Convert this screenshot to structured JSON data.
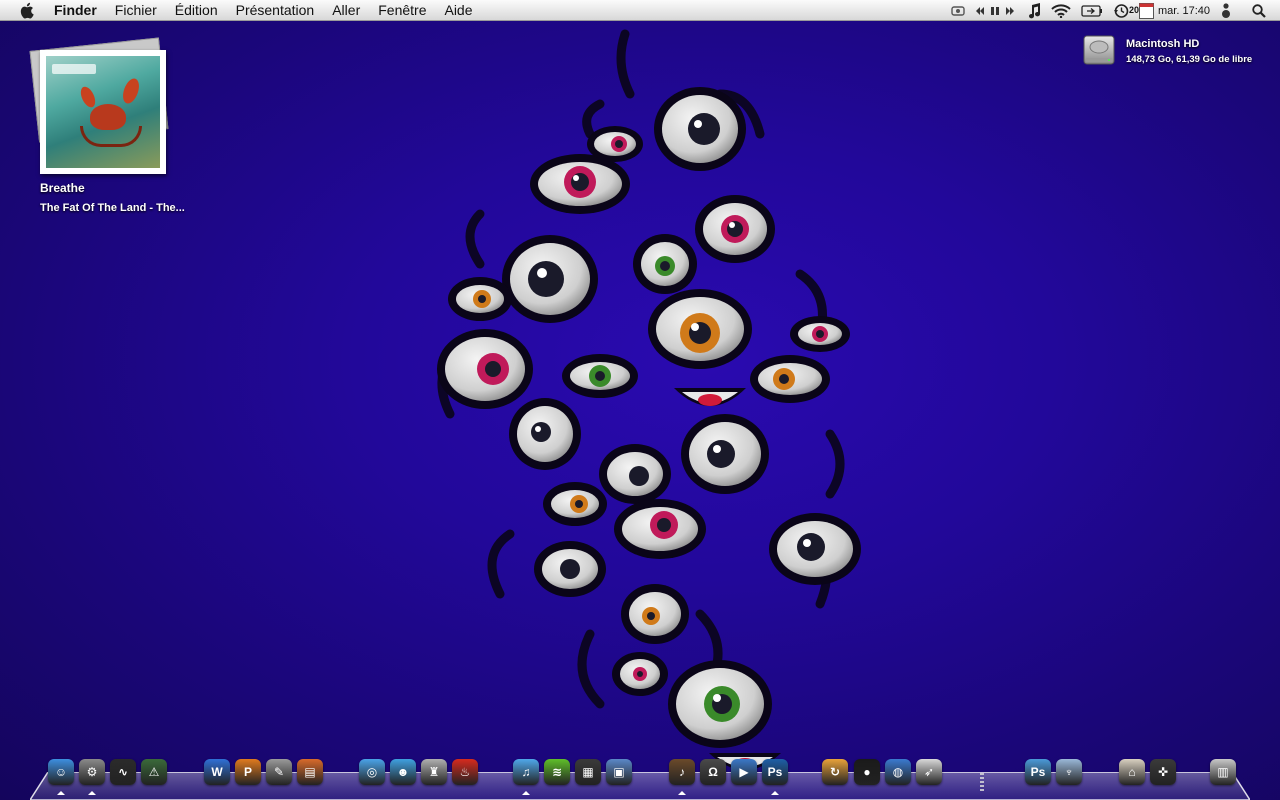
{
  "menubar": {
    "apple_icon": "apple-icon",
    "app_name": "Finder",
    "menus": [
      "Fichier",
      "Édition",
      "Présentation",
      "Aller",
      "Fenêtre",
      "Aide"
    ],
    "status": {
      "date_day": "20",
      "clock": "mar. 17:40"
    }
  },
  "album": {
    "title": "Breathe",
    "subtitle": "The Fat Of The Land - The..."
  },
  "disk": {
    "name": "Macintosh HD",
    "info": "148,73 Go, 61,39 Go de libre"
  },
  "dock": {
    "items": [
      {
        "name": "finder",
        "icon": "finder-icon",
        "color": "#3d8fe0",
        "running": true
      },
      {
        "name": "system-preferences",
        "icon": "gear-icon",
        "color": "#8a8a8a",
        "running": true
      },
      {
        "name": "activity-monitor",
        "icon": "activity-monitor-icon",
        "color": "#2b2b2b",
        "running": false
      },
      {
        "name": "console",
        "icon": "console-icon",
        "color": "#3a6a3a",
        "running": false
      },
      {
        "name": "word",
        "icon": "word-icon",
        "color": "#2f6fd6",
        "running": false
      },
      {
        "name": "powerpoint",
        "icon": "powerpoint-icon",
        "color": "#e07a1e",
        "running": false
      },
      {
        "name": "script-editor",
        "icon": "script-editor-icon",
        "color": "#9a9a9a",
        "running": false
      },
      {
        "name": "keynote",
        "icon": "keynote-icon",
        "color": "#d86a2a",
        "running": false
      },
      {
        "name": "safari",
        "icon": "safari-icon",
        "color": "#4aa3e8",
        "running": false
      },
      {
        "name": "messenger",
        "icon": "messenger-icon",
        "color": "#3fa0e0",
        "running": false
      },
      {
        "name": "growl",
        "icon": "growl-icon",
        "color": "#b0b0b0",
        "running": false
      },
      {
        "name": "fire-app",
        "icon": "fire-icon",
        "color": "#d62a1e",
        "running": false
      },
      {
        "name": "itunes",
        "icon": "itunes-icon",
        "color": "#4fa8ea",
        "running": true
      },
      {
        "name": "spotify",
        "icon": "spotify-icon",
        "color": "#5fbf2a",
        "running": false
      },
      {
        "name": "imovie",
        "icon": "imovie-icon",
        "color": "#3a3a3a",
        "running": false
      },
      {
        "name": "iphoto",
        "icon": "iphoto-icon",
        "color": "#5a88c8",
        "running": false
      },
      {
        "name": "garageband",
        "icon": "guitar-icon",
        "color": "#6b4a2a",
        "running": true
      },
      {
        "name": "headphones-app",
        "icon": "headphones-icon",
        "color": "#4a4a4a",
        "running": false
      },
      {
        "name": "final-cut",
        "icon": "clapper-icon",
        "color": "#3a78c8",
        "running": false
      },
      {
        "name": "photoshop",
        "icon": "photoshop-icon",
        "color": "#1d5fa8",
        "running": true
      },
      {
        "name": "flip-app",
        "icon": "flip-icon",
        "color": "#e8a23a",
        "running": false
      },
      {
        "name": "plum-app",
        "icon": "plum-icon",
        "color": "#1a1a1a",
        "running": false
      },
      {
        "name": "google-earth",
        "icon": "globe-icon",
        "color": "#3a7ad0",
        "running": false
      },
      {
        "name": "rocket-app",
        "icon": "rocket-icon",
        "color": "#d8d8d8",
        "running": false
      },
      {
        "name": "photoshop-folder",
        "icon": "photoshop-folder-icon",
        "color": "#4a9ad8",
        "running": false
      },
      {
        "name": "podcast-folder",
        "icon": "microphone-folder-icon",
        "color": "#9ab8d8",
        "running": false
      },
      {
        "name": "home-folder",
        "icon": "home-icon",
        "color": "#d8d0c0",
        "running": false
      },
      {
        "name": "games-folder",
        "icon": "gamepad-icon",
        "color": "#3a3a3a",
        "running": false
      },
      {
        "name": "trash",
        "icon": "trash-icon",
        "color": "#c8c8c8",
        "running": false
      }
    ]
  }
}
